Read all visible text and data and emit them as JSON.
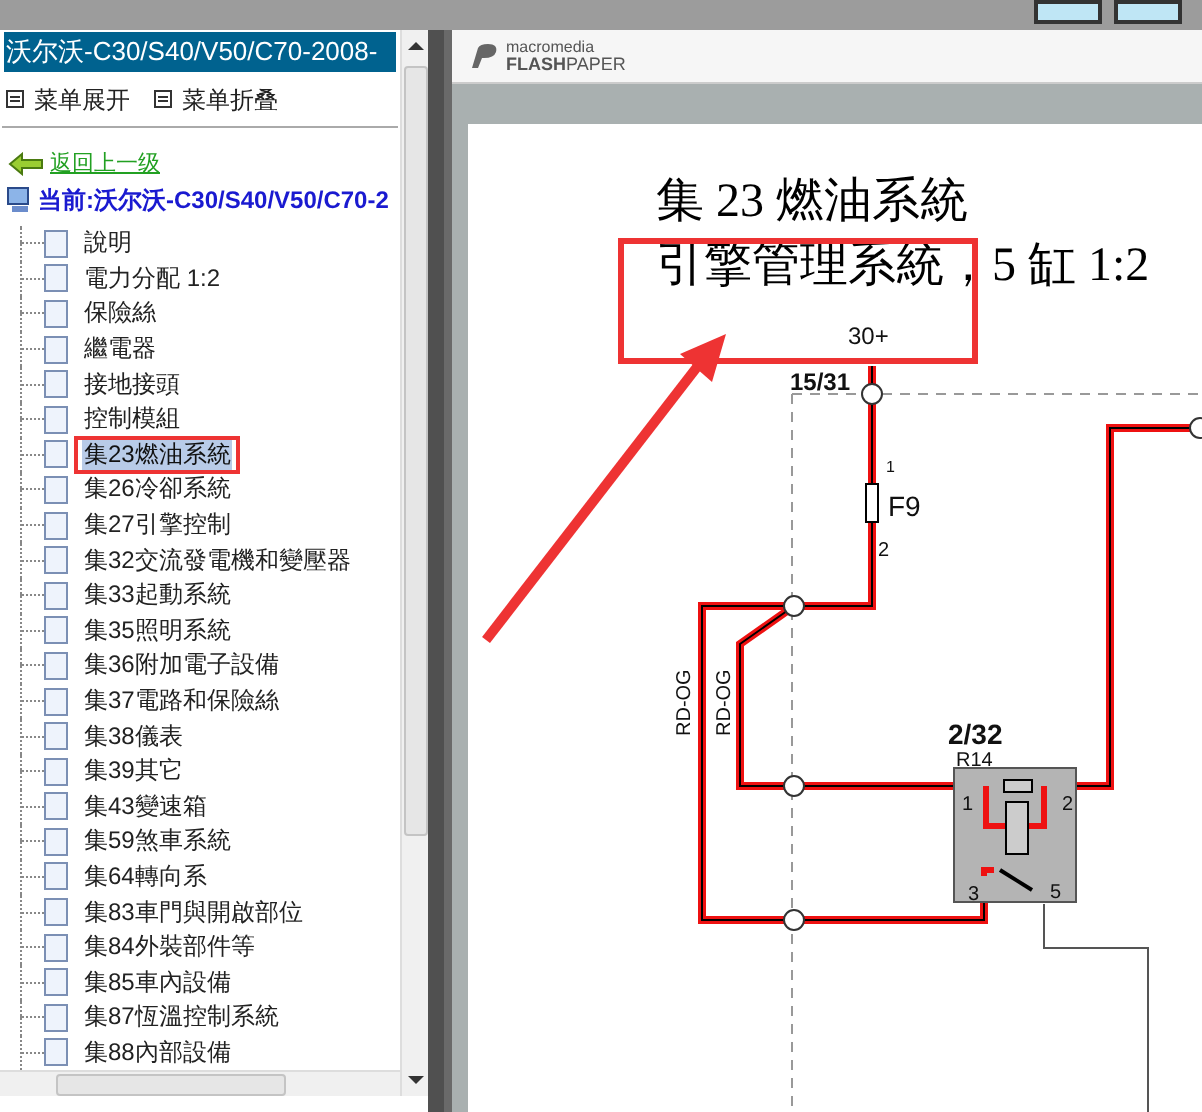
{
  "sidebar": {
    "title": "沃尔沃-C30/S40/V50/C70-2008-",
    "toolbar": [
      {
        "label": "菜单展开"
      },
      {
        "label": "菜单折叠"
      }
    ],
    "back_link": "返回上一级",
    "current": "当前:沃尔沃-C30/S40/V50/C70-2",
    "items": [
      {
        "label": "說明",
        "selected": false
      },
      {
        "label": "電力分配 1:2",
        "selected": false
      },
      {
        "label": "保險絲",
        "selected": false
      },
      {
        "label": "繼電器",
        "selected": false
      },
      {
        "label": "接地接頭",
        "selected": false
      },
      {
        "label": "控制模組",
        "selected": false
      },
      {
        "label": "集23燃油系統",
        "selected": true
      },
      {
        "label": "集26冷卻系統",
        "selected": false
      },
      {
        "label": "集27引擎控制",
        "selected": false
      },
      {
        "label": "集32交流發電機和變壓器",
        "selected": false
      },
      {
        "label": "集33起動系統",
        "selected": false
      },
      {
        "label": "集35照明系統",
        "selected": false
      },
      {
        "label": "集36附加電子設備",
        "selected": false
      },
      {
        "label": "集37電路和保險絲",
        "selected": false
      },
      {
        "label": "集38儀表",
        "selected": false
      },
      {
        "label": "集39其它",
        "selected": false
      },
      {
        "label": "集43變速箱",
        "selected": false
      },
      {
        "label": "集59煞車系統",
        "selected": false
      },
      {
        "label": "集64轉向系",
        "selected": false
      },
      {
        "label": "集83車門與開啟部位",
        "selected": false
      },
      {
        "label": "集84外裝部件等",
        "selected": false
      },
      {
        "label": "集85車內設備",
        "selected": false
      },
      {
        "label": "集87恆溫控制系統",
        "selected": false
      },
      {
        "label": "集88內部設備",
        "selected": false
      }
    ]
  },
  "viewer": {
    "brand_top": "macromedia",
    "brand_bottom": "**FLASH**PAPER",
    "document": {
      "title_lines": [
        "集 23 燃油系統",
        "引擎管理系統，5 缸  1:2"
      ],
      "diagram_labels": [
        "30+",
        "15/31",
        "1",
        "F9",
        "2",
        "RD-OG",
        "RD-OG",
        "2/32",
        "R14",
        "1",
        "2",
        "3",
        "5"
      ]
    }
  }
}
